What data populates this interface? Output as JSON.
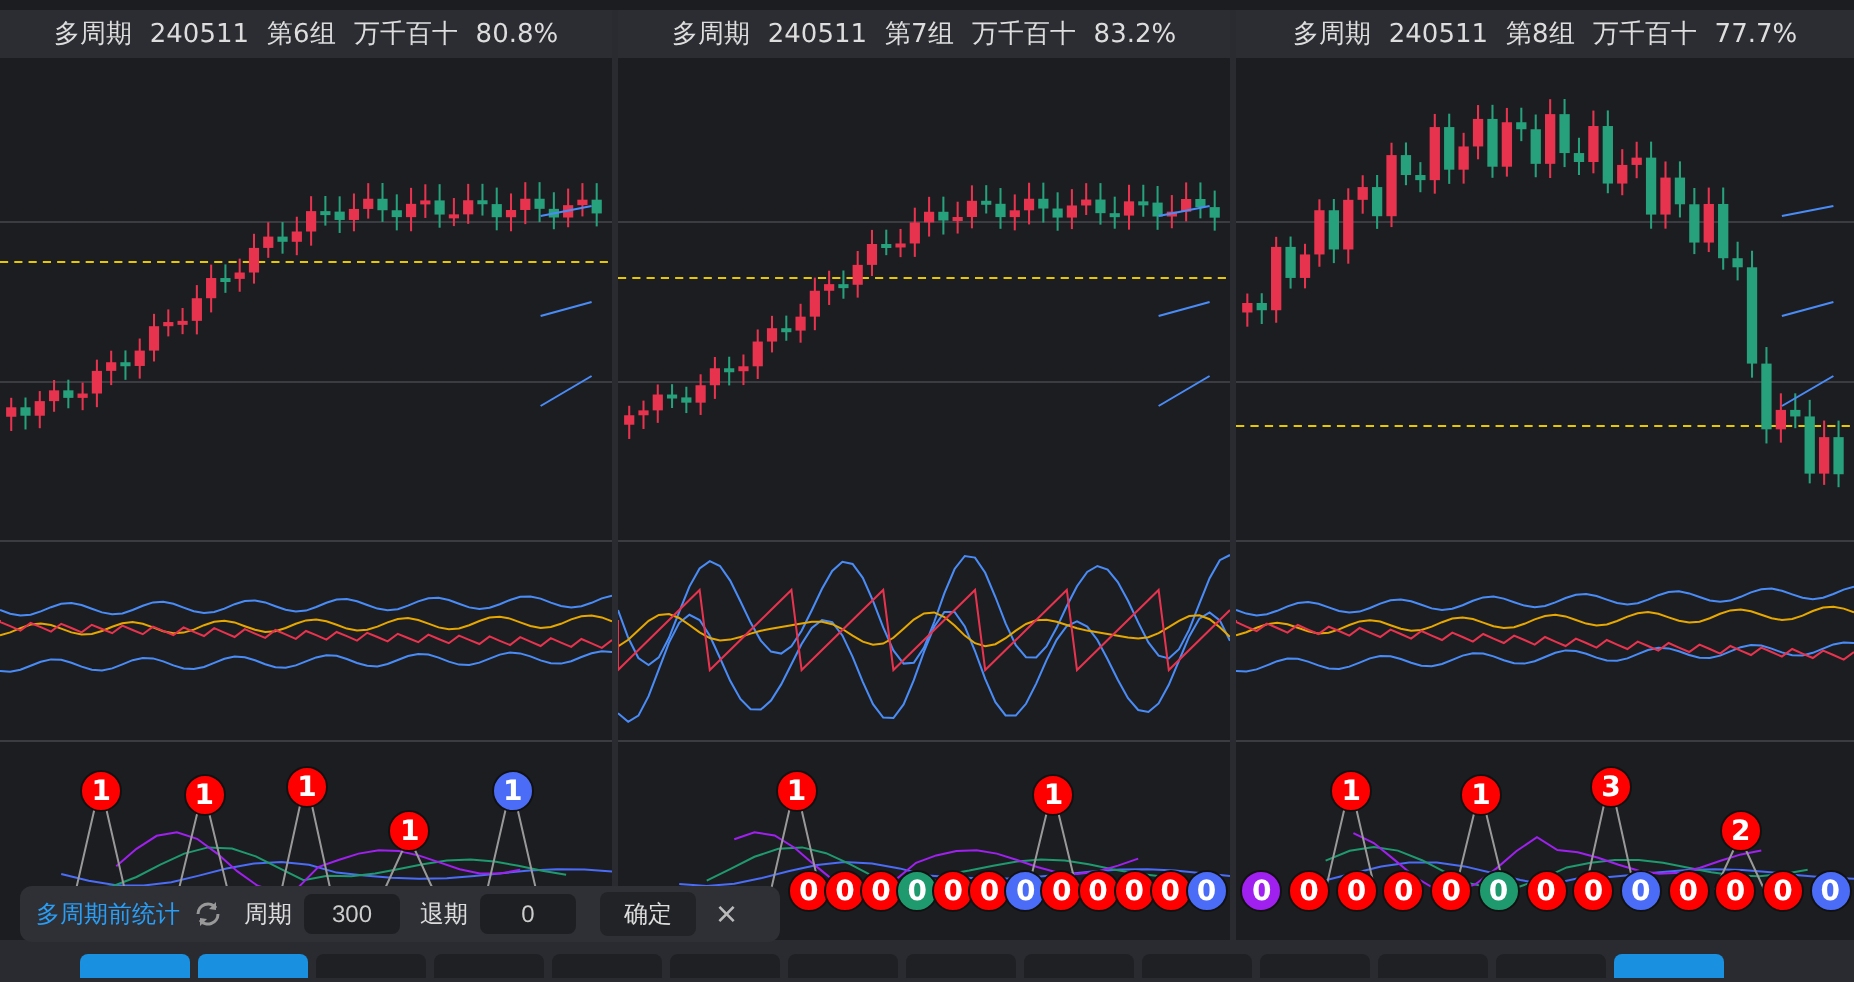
{
  "panels": [
    {
      "header": [
        "多周期",
        "240511",
        "第6组",
        "万千百十",
        "80.8%"
      ],
      "top_markers": [
        {
          "label": "1",
          "color": "#ff0000"
        },
        {
          "label": "1",
          "color": "#ff0000"
        },
        {
          "label": "1",
          "color": "#ff0000"
        },
        {
          "label": "1",
          "color": "#ff0000"
        },
        {
          "label": "1",
          "color": "#4a6cf7"
        }
      ]
    },
    {
      "header": [
        "多周期",
        "240511",
        "第7组",
        "万千百十",
        "83.2%"
      ],
      "top_markers": [
        {
          "label": "1",
          "color": "#ff0000"
        },
        {
          "label": "1",
          "color": "#ff0000"
        }
      ],
      "bottom_markers": [
        {
          "label": "0",
          "color": "#ff0000"
        },
        {
          "label": "0",
          "color": "#ff0000"
        },
        {
          "label": "0",
          "color": "#ff0000"
        },
        {
          "label": "0",
          "color": "#1f9a6e"
        },
        {
          "label": "0",
          "color": "#ff0000"
        },
        {
          "label": "0",
          "color": "#ff0000"
        },
        {
          "label": "0",
          "color": "#4a6cf7"
        },
        {
          "label": "0",
          "color": "#ff0000"
        },
        {
          "label": "0",
          "color": "#ff0000"
        },
        {
          "label": "0",
          "color": "#ff0000"
        },
        {
          "label": "0",
          "color": "#ff0000"
        },
        {
          "label": "0",
          "color": "#4a6cf7"
        }
      ]
    },
    {
      "header": [
        "多周期",
        "240511",
        "第8组",
        "万千百十",
        "77.7%"
      ],
      "top_markers": [
        {
          "label": "1",
          "color": "#ff0000"
        },
        {
          "label": "1",
          "color": "#ff0000"
        },
        {
          "label": "3",
          "color": "#ff0000"
        },
        {
          "label": "2",
          "color": "#ff0000"
        }
      ],
      "bottom_markers": [
        {
          "label": "0",
          "color": "#a020f0"
        },
        {
          "label": "0",
          "color": "#ff0000"
        },
        {
          "label": "0",
          "color": "#ff0000"
        },
        {
          "label": "0",
          "color": "#ff0000"
        },
        {
          "label": "0",
          "color": "#ff0000"
        },
        {
          "label": "0",
          "color": "#1f9a6e"
        },
        {
          "label": "0",
          "color": "#ff0000"
        },
        {
          "label": "0",
          "color": "#ff0000"
        },
        {
          "label": "0",
          "color": "#4a6cf7"
        },
        {
          "label": "0",
          "color": "#ff0000"
        },
        {
          "label": "0",
          "color": "#ff0000"
        },
        {
          "label": "0",
          "color": "#ff0000"
        },
        {
          "label": "0",
          "color": "#4a6cf7"
        }
      ]
    }
  ],
  "toolbar": {
    "title": "多周期前统计",
    "period_label": "周期",
    "period_value": "300",
    "back_label": "退期",
    "back_value": "0",
    "confirm": "确定",
    "close": "×"
  },
  "bottom_tabs": [
    {
      "selected": true
    },
    {
      "selected": true
    },
    {
      "selected": false
    },
    {
      "selected": false
    },
    {
      "selected": false
    },
    {
      "selected": false
    },
    {
      "selected": false
    },
    {
      "selected": false
    },
    {
      "selected": false
    },
    {
      "selected": false
    },
    {
      "selected": false
    },
    {
      "selected": false
    },
    {
      "selected": false
    },
    {
      "selected": true
    }
  ]
}
